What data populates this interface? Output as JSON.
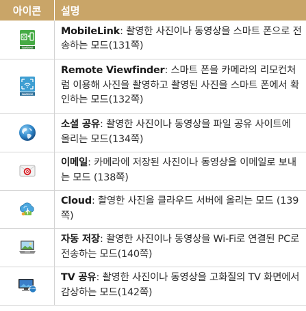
{
  "header": {
    "icon_col": "아이콘",
    "desc_col": "설명"
  },
  "rows": [
    {
      "icon": "mobilelink-icon",
      "name": "MobileLink",
      "sep": ": ",
      "text": "촬영한 사진이나 동영상을 스마트 폰으로 전송하는 모드(131쪽)"
    },
    {
      "icon": "remote-viewfinder-icon",
      "name": "Remote Viewfinder",
      "sep": ": ",
      "text": "스마트 폰을 카메라의 리모컨처럼 이용해 사진을 촬영하고 촬영된 사진을 스마트 폰에서 확인하는 모드(132쪽)"
    },
    {
      "icon": "globe-icon",
      "name": "소셜 공유",
      "sep": ": ",
      "text": "촬영한 사진이나 동영상을 파일 공유 사이트에 올리는 모드(134쪽)"
    },
    {
      "icon": "email-icon",
      "name": "이메일",
      "sep": ": ",
      "text": "카메라에 저장된 사진이나 동영상을 이메일로 보내는 모드 (138쪽)"
    },
    {
      "icon": "cloud-icon",
      "name": "Cloud",
      "sep": ": ",
      "text": "촬영한 사진을 클라우드 서버에 올리는 모드 (139쪽)"
    },
    {
      "icon": "pc-autosave-icon",
      "name": "자동 저장",
      "sep": ": ",
      "text": "촬영한 사진이나 동영상을 Wi-Fi로 연결된 PC로 전송하는 모드(140쪽)"
    },
    {
      "icon": "tv-share-icon",
      "name": "TV 공유",
      "sep": ": ",
      "text": "촬영한 사진이나 동영상을 고화질의 TV 화면에서 감상하는 모드(142쪽)"
    }
  ],
  "icon_texts": {
    "samsung": "SAMSUNG",
    "allshare": "all share"
  },
  "colors": {
    "header_bg": "#c9a568",
    "rule": "#d3d3d3",
    "samsung_green": "#46ab45"
  }
}
